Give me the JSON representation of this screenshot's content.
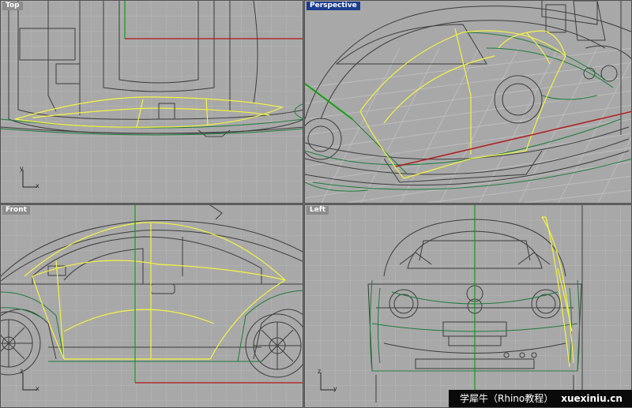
{
  "viewports": {
    "top": {
      "label": "Top",
      "axis_v": "y",
      "axis_h": "x"
    },
    "perspective": {
      "label": "Perspective"
    },
    "front": {
      "label": "Front",
      "axis_v": "z",
      "axis_h": "x"
    },
    "left": {
      "label": "Left",
      "axis_v": "z",
      "axis_h": "y"
    }
  },
  "watermark": {
    "text": "学犀牛（Rhino教程）",
    "site": "xuexiniu.cn"
  },
  "colors": {
    "viewport_bg": "#a8a8a8",
    "grid": "#b9b9b9",
    "axis_x": "#b01818",
    "axis_y": "#10a010",
    "curve_yellow": "#f4f444",
    "curve_green": "#1f7a3c",
    "active_label": "#1b3c8f"
  }
}
